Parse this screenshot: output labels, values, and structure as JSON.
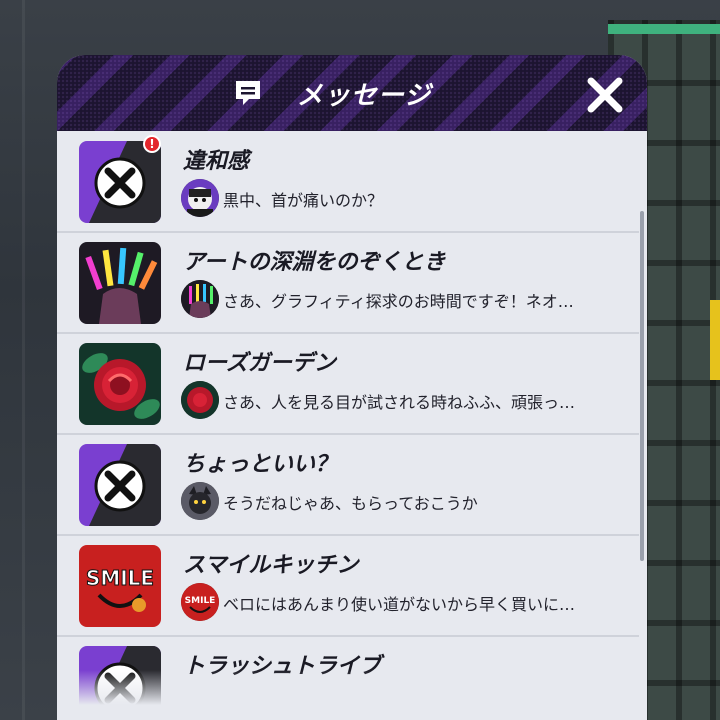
{
  "header": {
    "title": "メッセージ",
    "icon": "message-icon",
    "close_icon": "close-icon"
  },
  "threads": [
    {
      "title": "違和感",
      "preview": "黒中、首が痛いのか？",
      "icon": "x-emblem-icon",
      "avatar": "masked-character-avatar",
      "unread_badge": "!"
    },
    {
      "title": "アートの深淵をのぞくとき",
      "preview": "さあ、グラフィティ探求のお時間ですぞ！ネオ…",
      "icon": "glowstick-hand-icon",
      "avatar": "glowstick-hand-avatar"
    },
    {
      "title": "ローズガーデン",
      "preview": "さあ、人を見る目が試される時ねふふ、頑張っ…",
      "icon": "rose-icon",
      "avatar": "rose-avatar"
    },
    {
      "title": "ちょっといい？",
      "preview": "そうだねじゃあ、もらっておこうか",
      "icon": "x-emblem-icon",
      "avatar": "cat-character-avatar"
    },
    {
      "title": "スマイルキッチン",
      "preview": "ベロにはあんまり使い道がないから早く買いに…",
      "icon": "smile-logo-icon",
      "avatar": "smile-logo-avatar",
      "logo_text": "SMILE"
    },
    {
      "title": "トラッシュトライブ",
      "preview": "",
      "icon": "x-emblem-icon"
    }
  ],
  "colors": {
    "header_bg": "#1c1430",
    "accent_purple": "#7a3fd0",
    "badge_red": "#e3262c",
    "panel_bg": "#e7e9ef"
  }
}
